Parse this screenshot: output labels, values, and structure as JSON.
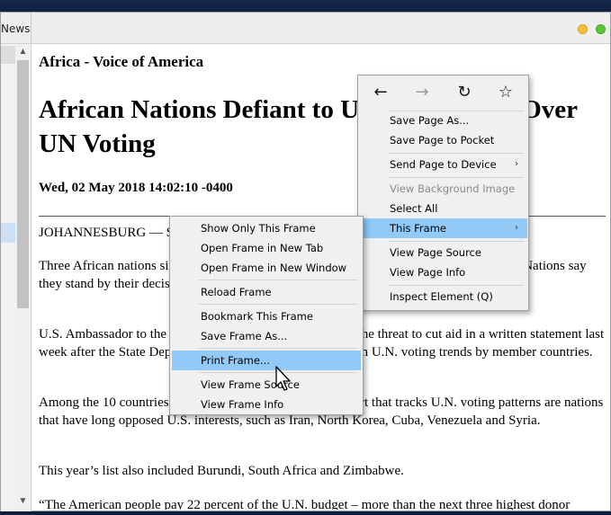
{
  "window": {
    "title_fragment": "News"
  },
  "article": {
    "source": "Africa - Voice of America",
    "headline": "African Nations Defiant to U.S. Aid Threat Over UN Voting",
    "date": "Wed, 02 May 2018 14:02:10 -0400",
    "paragraphs": [
      "JOHANNESBURG — Several African nations are defiant",
      "Three African nations singled out by the U.S. for voting against the country at the United Nations say they stand by their decisions, despite Washington's threat of cutting back on aid.",
      "U.S. Ambassador to the United Nations Nikki Haley made the threat to cut aid in a written statement last week after the State Department released its annual report on U.N. voting trends by member countries.",
      "Among the 10 countries listed in the State Department report that tracks U.N. voting patterns are nations that have long opposed U.S. interests, such as Iran, North Korea, Cuba, Venezuela and Syria.",
      "This year’s list also included Burundi, South Africa and Zimbabwe.",
      "“The American people pay 22 percent of the U.N. budget – more than the next three highest donor"
    ]
  },
  "context_menu": {
    "nav": [
      {
        "name": "back-icon",
        "glyph": "←",
        "disabled": false
      },
      {
        "name": "forward-icon",
        "glyph": "→",
        "disabled": true
      },
      {
        "name": "reload-icon",
        "glyph": "↻",
        "disabled": false
      },
      {
        "name": "bookmark-star-icon",
        "glyph": "☆",
        "disabled": false
      }
    ],
    "items": {
      "save_page_as": "Save Page As...",
      "save_page_to_pocket": "Save Page to Pocket",
      "send_page_to_device": "Send Page to Device",
      "view_background_image": "View Background Image",
      "select_all": "Select All",
      "this_frame": "This Frame",
      "view_page_source": "View Page Source",
      "view_page_info": "View Page Info",
      "inspect_element": "Inspect Element (Q)"
    },
    "submenu_arrow": "›"
  },
  "frame_submenu": {
    "items": {
      "show_only_this_frame": "Show Only This Frame",
      "open_frame_new_tab": "Open Frame in New Tab",
      "open_frame_new_window": "Open Frame in New Window",
      "reload_frame": "Reload Frame",
      "bookmark_this_frame": "Bookmark This Frame",
      "save_frame_as": "Save Frame As...",
      "print_frame": "Print Frame...",
      "view_frame_source": "View Frame Source",
      "view_frame_info": "View Frame Info"
    }
  },
  "scrollbar": {
    "up_glyph": "▲",
    "down_glyph": "▼"
  },
  "colors": {
    "menu_highlight": "#91c9f7",
    "traffic_minimize": "#f5bf3a",
    "traffic_maximize": "#5ac43b"
  }
}
